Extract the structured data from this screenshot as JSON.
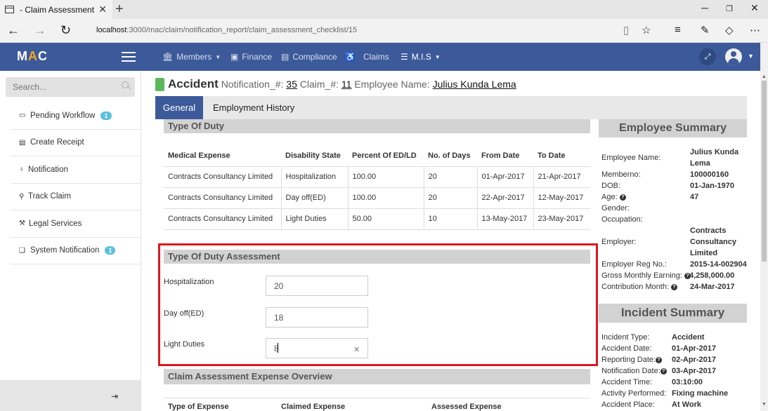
{
  "browser": {
    "tab_title": "- Claim Assessment",
    "url_host": "localhost",
    "url_path": ":3000/mac/claim/notification_report/claim_assessment_checklist/15"
  },
  "navbar": {
    "brand_m": "M",
    "brand_a": "A",
    "brand_c": "C",
    "items": [
      {
        "label": "Members",
        "icon": "bank-icon"
      },
      {
        "label": "Finance",
        "icon": "money-icon"
      },
      {
        "label": "Compliance",
        "icon": "book-icon"
      },
      {
        "label": "Claims",
        "icon": "wheelchair-icon"
      },
      {
        "label": "M.I.S",
        "icon": "list-icon"
      }
    ],
    "colors": {
      "bar": "#3c5a99",
      "accent": "#f6a821"
    }
  },
  "sidebar": {
    "search_placeholder": "Search...",
    "items": [
      {
        "label": "Pending Workflow",
        "icon": "inbox-icon",
        "badge": "1"
      },
      {
        "label": "Create Receipt",
        "icon": "receipt-icon",
        "badge": ""
      },
      {
        "label": "Notification",
        "icon": "bell-icon",
        "badge": ""
      },
      {
        "label": "Track Claim",
        "icon": "track-icon",
        "badge": ""
      },
      {
        "label": "Legal Services",
        "icon": "gavel-icon",
        "badge": ""
      },
      {
        "label": "System Notification",
        "icon": "comments-icon",
        "badge": "1"
      }
    ]
  },
  "header": {
    "title": "Accident",
    "notification_label": "Notification_#:",
    "notification_no": "35",
    "claim_label": "Claim_#:",
    "claim_no": "11",
    "employee_label": "Employee Name:",
    "employee_name": "Julius Kunda Lema"
  },
  "tabs": {
    "general": "General",
    "employment_history": "Employment History"
  },
  "type_of_duty": {
    "title": "Type Of Duty",
    "columns": [
      "Medical Expense",
      "Disability State",
      "Percent Of ED/LD",
      "No. of Days",
      "From Date",
      "To Date"
    ],
    "rows": [
      [
        "Contracts Consultancy Limited",
        "Hospitalization",
        "100.00",
        "20",
        "01-Apr-2017",
        "21-Apr-2017"
      ],
      [
        "Contracts Consultancy Limited",
        "Day off(ED)",
        "100.00",
        "20",
        "22-Apr-2017",
        "12-May-2017"
      ],
      [
        "Contracts Consultancy Limited",
        "Light Duties",
        "50.00",
        "10",
        "13-May-2017",
        "23-May-2017"
      ]
    ]
  },
  "assessment": {
    "title": "Type Of Duty Assessment",
    "fields": [
      {
        "label": "Hospitalization",
        "value": "20"
      },
      {
        "label": "Day off(ED)",
        "value": "18"
      },
      {
        "label": "Light Duties",
        "value": "8"
      }
    ]
  },
  "overview": {
    "title": "Claim Assessment Expense Overview",
    "columns": [
      "Type of Expense",
      "Claimed Expense",
      "Assessed Expense"
    ]
  },
  "employee_summary": {
    "title": "Employee Summary",
    "name_label": "Employee Name:",
    "name_line1": "Julius Kunda",
    "name_line2": "Lema",
    "memberno_label": "Memberno:",
    "memberno": "100000160",
    "dob_label": "DOB:",
    "dob": "01-Jan-1970",
    "age_label": "Age:",
    "age": "47",
    "gender_label": "Gender:",
    "occupation_label": "Occupation:",
    "employer_label": "Employer:",
    "employer_line1": "Contracts",
    "employer_line2": "Consultancy",
    "employer_line3": "Limited",
    "reg_label": "Employer Reg No.:",
    "reg_no": "2015-14-002904",
    "gross_label": "Gross Monthly Earning:",
    "gross": "4,258,000.00",
    "contrib_label": "Contribution Month:",
    "contrib": "24-Mar-2017"
  },
  "incident_summary": {
    "title": "Incident Summary",
    "type_label": "Incident Type:",
    "type": "Accident",
    "date_label": "Accident Date:",
    "date": "01-Apr-2017",
    "reporting_label": "Reporting Date:",
    "reporting": "02-Apr-2017",
    "notif_label": "Notification Date:",
    "notif": "03-Apr-2017",
    "time_label": "Accident Time:",
    "time": "03:10:00",
    "activity_label": "Activity Performed:",
    "activity": "Fixing machine",
    "place_label": "Accident Place:",
    "place": "At Work"
  }
}
